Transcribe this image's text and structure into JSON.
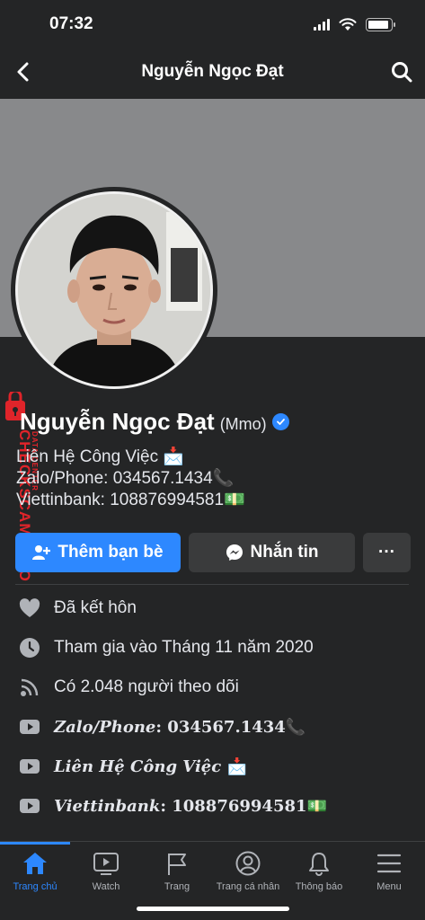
{
  "status_bar": {
    "time": "07:32",
    "battery_level": 0.9
  },
  "header": {
    "title": "Nguyễn Ngọc Đạt"
  },
  "profile": {
    "name": "Nguyễn Ngọc Đạt",
    "alternate_name": "(Mmo)",
    "bio_lines": [
      "Liên Hệ Công Việc 📩",
      "Zalo/Phone: 034567.1434📞",
      "Viettinbank: 108876994581💵"
    ]
  },
  "actions": {
    "add_friend": "Thêm bạn bè",
    "message": "Nhắn tin",
    "more": "···"
  },
  "details": [
    {
      "icon": "heart-icon",
      "text": "Đã kết hôn"
    },
    {
      "icon": "clock-icon",
      "text": "Tham gia vào Tháng 11 năm 2020"
    },
    {
      "icon": "rss-icon",
      "text": "Có 2.048 người theo dõi"
    }
  ],
  "links": [
    {
      "icon": "youtube-icon",
      "label": "Zalo/Phone",
      "value": ": 034567.1434📞"
    },
    {
      "icon": "youtube-icon",
      "label": "Liên Hệ Công Việc",
      "value": " 📩"
    },
    {
      "icon": "youtube-icon",
      "label": "Viettinbank",
      "value": ": 108876994581💵"
    }
  ],
  "watermark": {
    "main": "CHECKSCAM.INFO",
    "sub": "DATA CENTER"
  },
  "tabs": [
    {
      "label": "Trang chủ",
      "icon": "home-icon",
      "active": true
    },
    {
      "label": "Watch",
      "icon": "watch-icon",
      "active": false
    },
    {
      "label": "Trang",
      "icon": "flag-icon",
      "active": false
    },
    {
      "label": "Trang cá nhân",
      "icon": "profile-icon",
      "active": false
    },
    {
      "label": "Thông báo",
      "icon": "bell-icon",
      "active": false
    },
    {
      "label": "Menu",
      "icon": "menu-icon",
      "active": false
    }
  ],
  "colors": {
    "accent": "#2d88ff",
    "background": "#242526",
    "button_secondary": "#3a3b3c",
    "watermark": "#e0242a"
  }
}
